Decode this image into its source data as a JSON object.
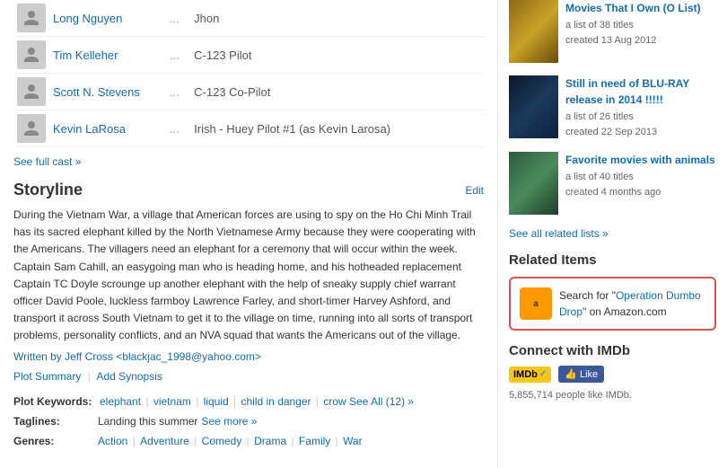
{
  "cast": [
    {
      "name": "Long Nguyen",
      "role": "Jhon"
    },
    {
      "name": "Tim Kelleher",
      "role": "C-123 Pilot"
    },
    {
      "name": "Scott N. Stevens",
      "role": "C-123 Co-Pilot"
    },
    {
      "name": "Kevin LaRosa",
      "role": "Irish - Huey Pilot #1 (as Kevin Larosa)"
    }
  ],
  "see_full_cast": "See full cast »",
  "storyline": {
    "title": "Storyline",
    "edit_label": "Edit",
    "text": "During the Vietnam War, a village that American forces are using to spy on the Ho Chi Minh Trail has its sacred elephant killed by the North Vietnamese Army because they were cooperating with the Americans. The villagers need an elephant for a ceremony that will occur within the week. Captain Sam Cahill, an easygoing man who is heading home, and his hotheaded replacement Captain TC Doyle scrounge up another elephant with the help of sneaky supply chief warrant officer David Poole, luckless farmboy Lawrence Farley, and short-timer Harvey Ashford, and transport it across South Vietnam to get it to the village on time, running into all sorts of transport problems, personality conflicts, and an NVA squad that wants the Americans out of the village.",
    "written_by": "Written by Jeff Cross <blackjac_1998@yahoo.com>",
    "plot_summary": "Plot Summary",
    "add_synopsis": "Add Synopsis"
  },
  "plot_keywords": {
    "label": "Plot Keywords:",
    "keywords": [
      "elephant",
      "vietnam",
      "liquid",
      "child in danger",
      "crow"
    ],
    "see_all": "See All (12) »"
  },
  "taglines": {
    "label": "Taglines:",
    "text": "Landing this summer",
    "see_more": "See more »"
  },
  "genres": {
    "label": "Genres:",
    "items": [
      "Action",
      "Adventure",
      "Comedy",
      "Drama",
      "Family",
      "War"
    ]
  },
  "right_col": {
    "lists": [
      {
        "thumb_class": "thumb-affection",
        "title": "Movies That I Own (O List)",
        "meta_line1": "a list of 38 titles",
        "meta_line2": "created 13 Aug 2012"
      },
      {
        "thumb_class": "thumb-abyss",
        "title": "Still in need of BLU-RAY release in 2014 !!!!!",
        "meta_line1": "a list of 26 titles",
        "meta_line2": "created 22 Sep 2013"
      },
      {
        "thumb_class": "thumb-kecil",
        "title": "Favorite movies with animals",
        "meta_line1": "a list of 40 titles",
        "meta_line2": "created 4 months ago"
      }
    ],
    "see_related": "See all related lists »",
    "related_items_header": "Related Items",
    "amazon_text_prefix": "Search for \"",
    "amazon_link_text": "Operation Dumbo Drop",
    "amazon_text_suffix": "\" on Amazon.com",
    "connect_header": "Connect with IMDb",
    "imdb_label": "IMDb",
    "fb_like": "Like",
    "fb_count": "5,855,714 people like IMDb."
  }
}
